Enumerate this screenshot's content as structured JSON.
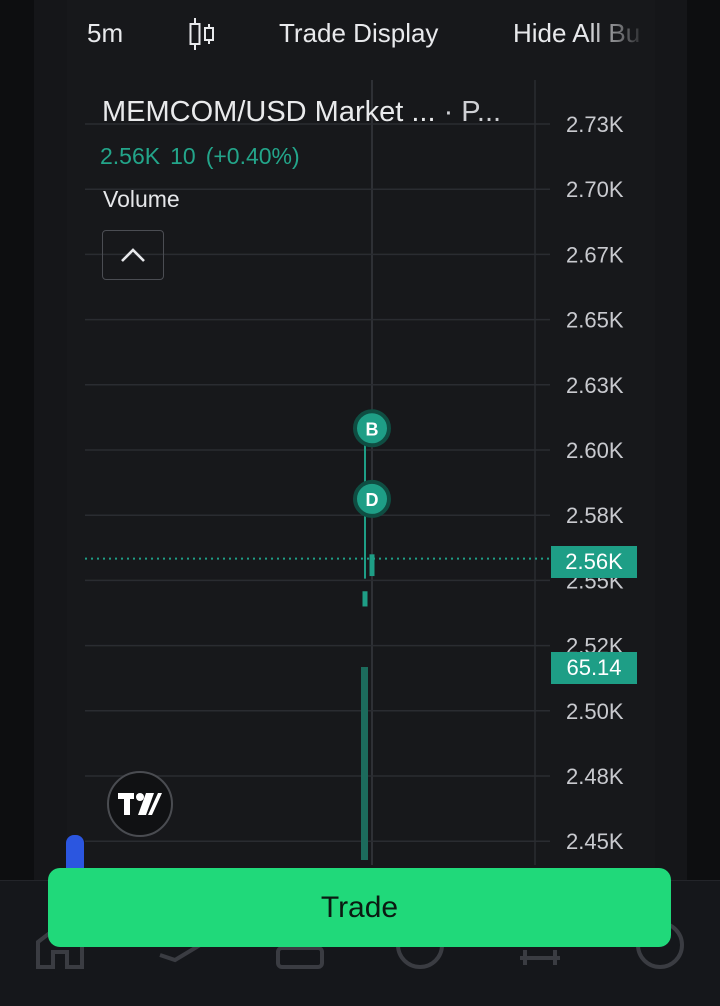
{
  "toolbar": {
    "interval": "5m",
    "chart_type_icon": "candlestick-icon",
    "trade_display": "Trade Display",
    "hide_all": "Hide All Bu"
  },
  "chart": {
    "title": "MEMCOM/USD Market ...",
    "title_suffix": "· P...",
    "last_price": "2.56K",
    "change_abs": "10",
    "change_pct": "(+0.40%)",
    "volume_label": "Volume",
    "collapse_icon": "chevron-up-icon",
    "price_badge": "2.56K",
    "volume_badge": "65.14",
    "buy_marker": "B",
    "d_marker": "D",
    "logo": "TV"
  },
  "chart_data": {
    "type": "candlestick",
    "y_ticks": [
      "2.73K",
      "2.70K",
      "2.67K",
      "2.65K",
      "2.63K",
      "2.60K",
      "2.58K",
      "2.55K",
      "2.52K",
      "2.50K",
      "2.48K",
      "2.45K"
    ],
    "y_tick_values": [
      2730,
      2700,
      2670,
      2650,
      2630,
      2600,
      2580,
      2550,
      2520,
      2500,
      2480,
      2450
    ],
    "last_price": 2560,
    "volume_last": 65.14,
    "candles": [
      {
        "open": 2545,
        "close": 2538,
        "high": 2546,
        "low": 2537
      },
      {
        "open": 2552,
        "close": 2562,
        "high": 2563,
        "low": 2551
      }
    ],
    "markers": [
      {
        "label": "B",
        "price": 2610
      },
      {
        "label": "D",
        "price": 2585
      }
    ],
    "grid": true,
    "colors": {
      "up": "#1e9e86",
      "down": "#1e9e86",
      "grid": "#2a2c31",
      "volume": "#1c6b5c"
    }
  },
  "actions": {
    "trade_label": "Trade"
  },
  "colors": {
    "accent_green": "#20d97a",
    "teal": "#1e9e86",
    "background": "#17181b"
  }
}
